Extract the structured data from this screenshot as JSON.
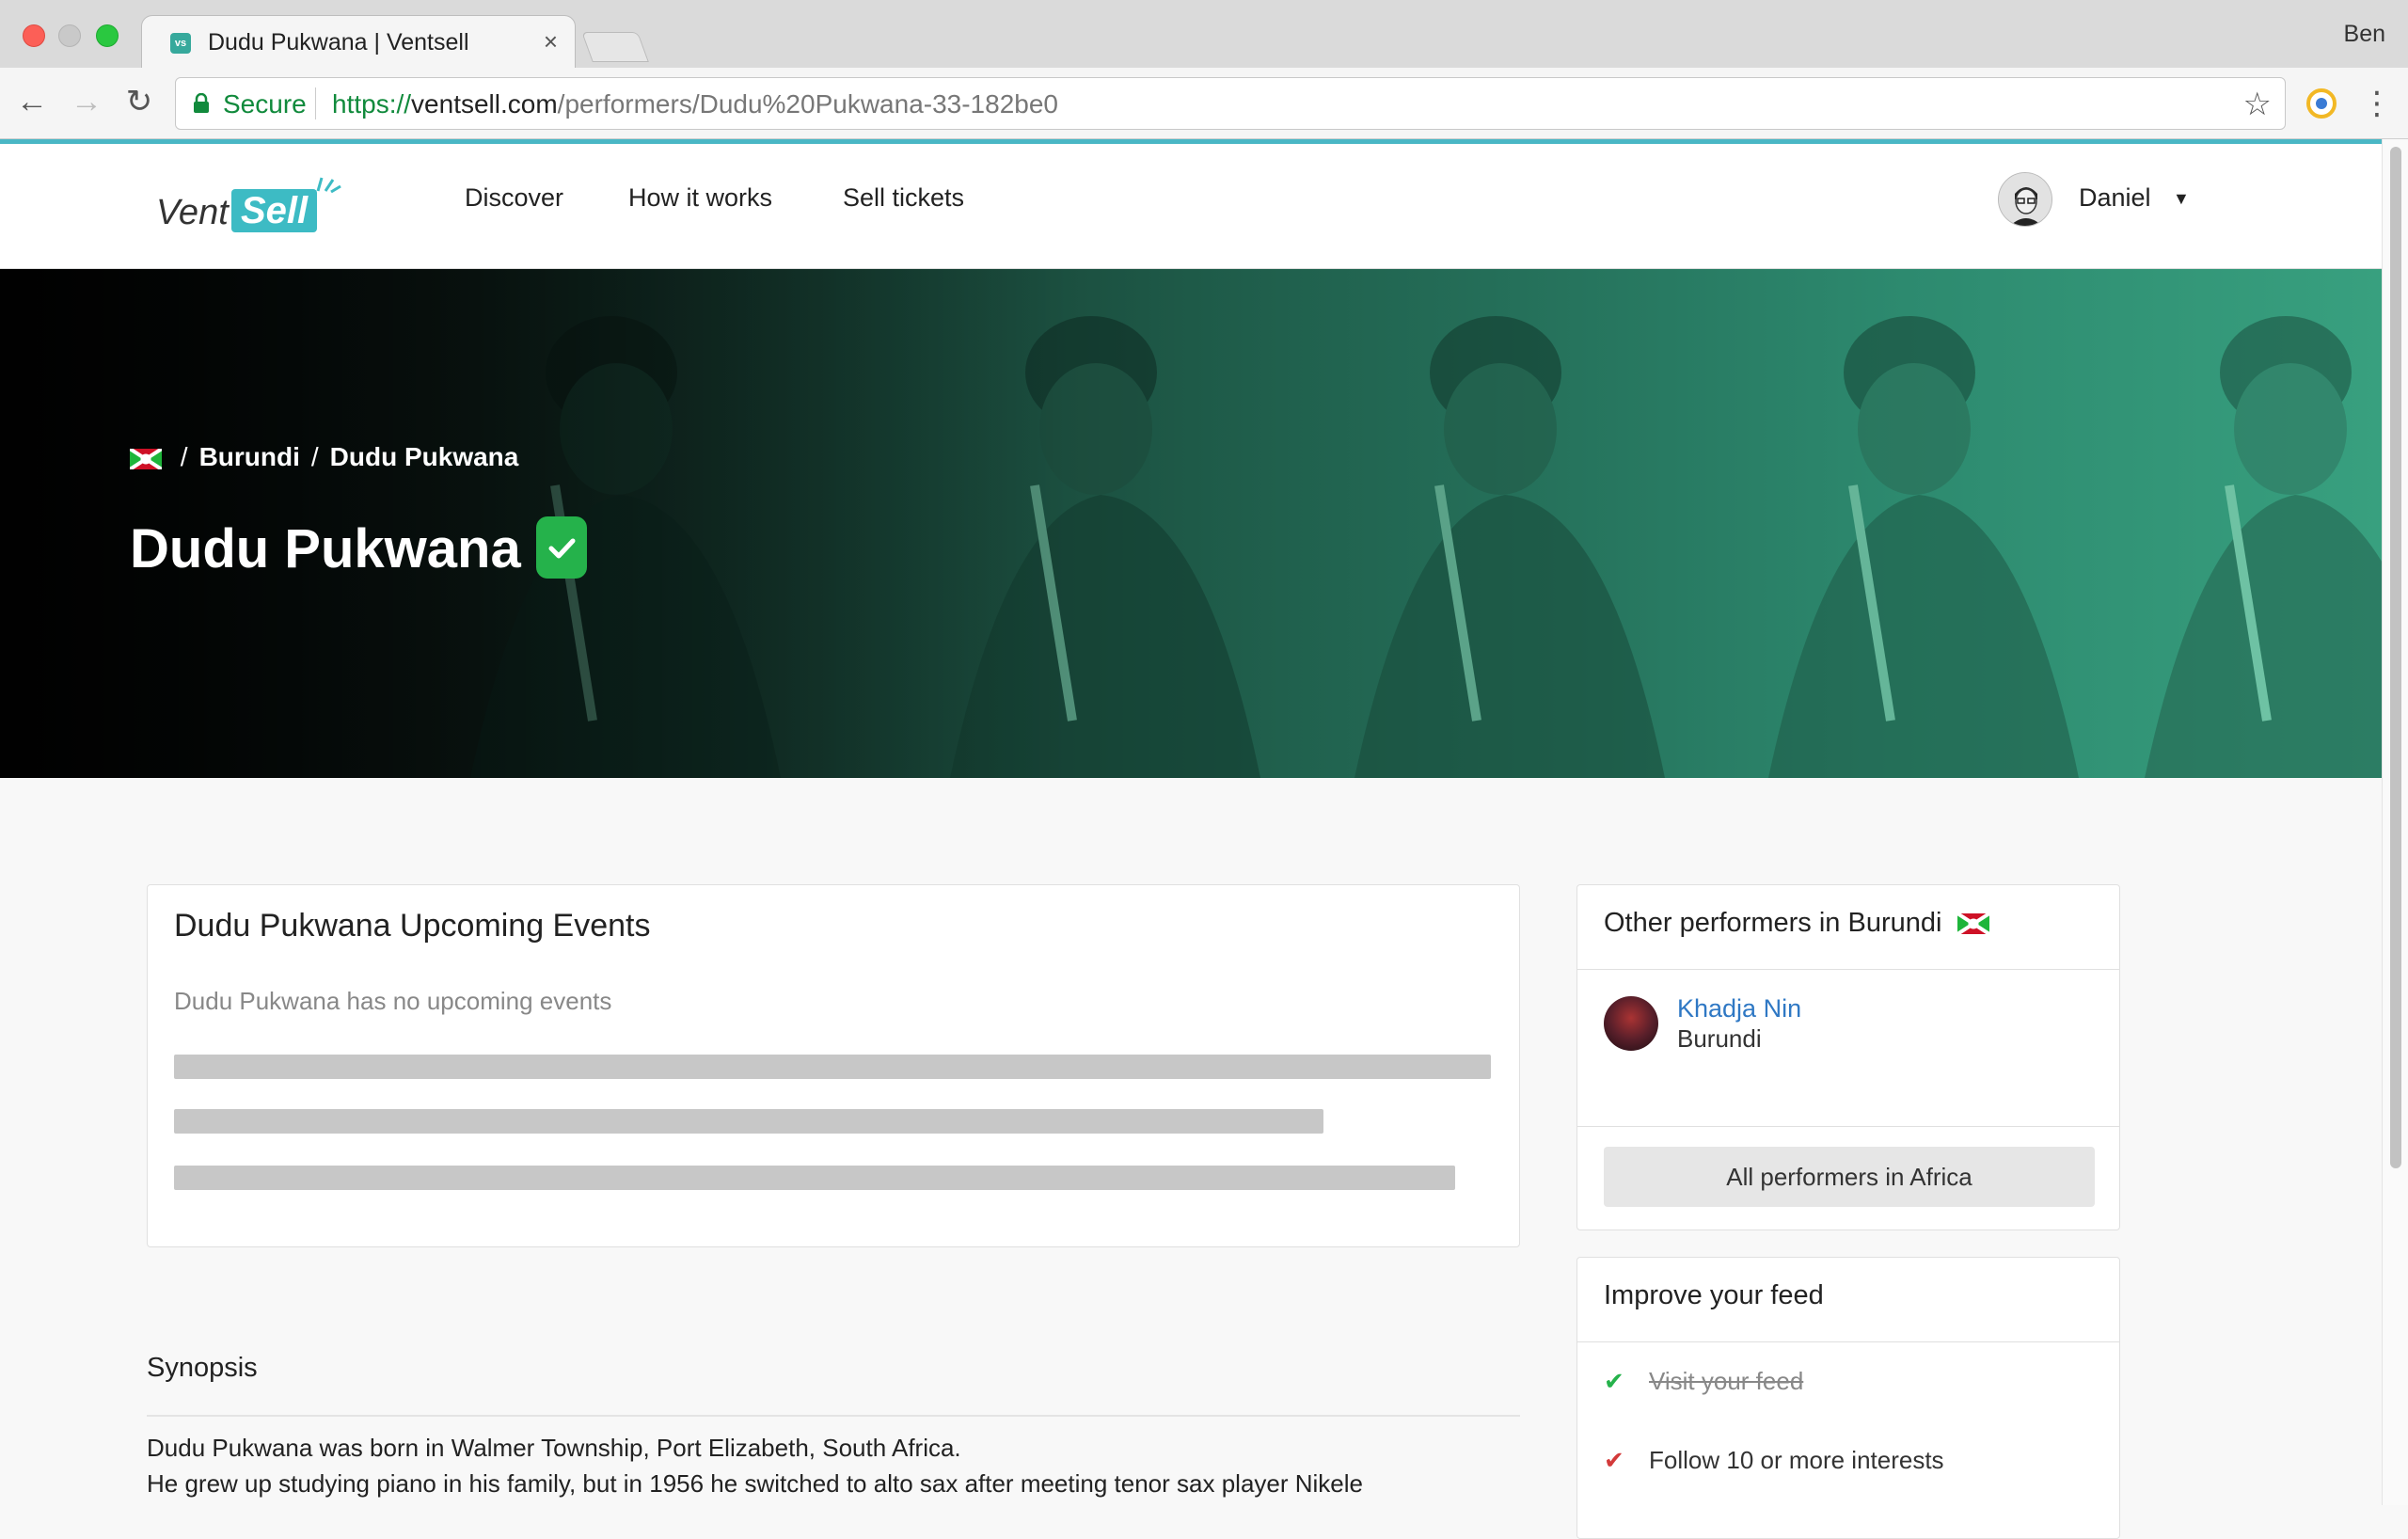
{
  "browser": {
    "tab_title": "Dudu Pukwana | Ventsell",
    "tab_favicon_text": "vs",
    "profile_name": "Ben",
    "secure_label": "Secure",
    "url_scheme": "https://",
    "url_host": "ventsell.com",
    "url_path": "/performers/Dudu%20Pukwana-33-182be0"
  },
  "header": {
    "logo_vent": "Vent",
    "logo_sell": "Sell",
    "nav": [
      "Discover",
      "How it works",
      "Sell tickets"
    ],
    "user_name": "Daniel"
  },
  "hero": {
    "breadcrumb_country": "Burundi",
    "breadcrumb_performer": "Dudu Pukwana",
    "title": "Dudu Pukwana"
  },
  "events": {
    "title": "Dudu Pukwana Upcoming Events",
    "empty_text": "Dudu Pukwana has no upcoming events"
  },
  "synopsis": {
    "title": "Synopsis",
    "lines": [
      "Dudu Pukwana was born in Walmer Township, Port Elizabeth, South Africa.",
      "He grew up studying piano in his family, but in 1956 he switched to alto sax after meeting tenor sax player Nikele"
    ]
  },
  "others": {
    "title": "Other performers in Burundi",
    "performers": [
      {
        "name": "Khadja Nin",
        "country": "Burundi"
      }
    ],
    "all_button": "All performers in Africa"
  },
  "feed": {
    "title": "Improve your feed",
    "items": [
      {
        "label": "Visit your feed",
        "done": true
      },
      {
        "label": "Follow 10 or more interests",
        "done": false
      }
    ]
  },
  "colors": {
    "accent": "#4ab7c5",
    "verified": "#25b24b",
    "link": "#2f78c4",
    "secure": "#118a3c"
  }
}
